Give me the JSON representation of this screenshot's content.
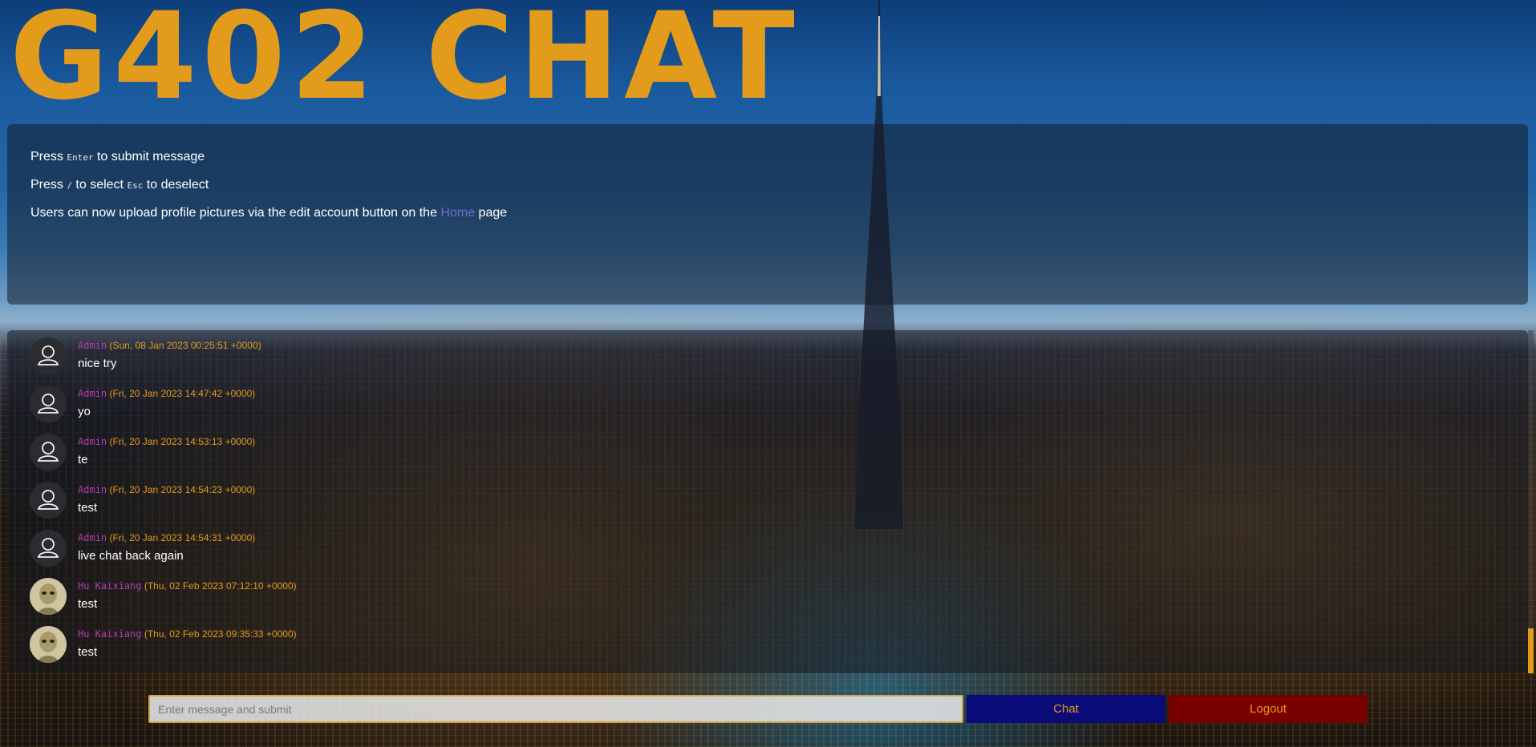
{
  "brand": {
    "title": "G402 CHAT"
  },
  "info": {
    "line1": {
      "pre": "Press ",
      "key": "Enter",
      "post": " to submit message"
    },
    "line2": {
      "pre": "Press ",
      "key1": "/",
      "mid": " to select ",
      "key2": "Esc",
      "post": " to deselect"
    },
    "line3": {
      "pre": "Users can now upload profile pictures via the edit account button on the ",
      "link": "Home",
      "post": " page"
    }
  },
  "messages": [
    {
      "author": "Admin",
      "timestamp": "(Sun, 08 Jan 2023 00:25:51 +0000)",
      "text": "nice try",
      "avatar": "default-user-icon"
    },
    {
      "author": "Admin",
      "timestamp": "(Fri, 20 Jan 2023 14:47:42 +0000)",
      "text": "yo",
      "avatar": "default-user-icon"
    },
    {
      "author": "Admin",
      "timestamp": "(Fri, 20 Jan 2023 14:53:13 +0000)",
      "text": "te",
      "avatar": "default-user-icon"
    },
    {
      "author": "Admin",
      "timestamp": "(Fri, 20 Jan 2023 14:54:23 +0000)",
      "text": "test",
      "avatar": "default-user-icon"
    },
    {
      "author": "Admin",
      "timestamp": "(Fri, 20 Jan 2023 14:54:31 +0000)",
      "text": "live chat back again",
      "avatar": "default-user-icon"
    },
    {
      "author": "Hu Kaixiang",
      "timestamp": "(Thu, 02 Feb 2023 07:12:10 +0000)",
      "text": "test",
      "avatar": "profile-photo"
    },
    {
      "author": "Hu Kaixiang",
      "timestamp": "(Thu, 02 Feb 2023 09:35:33 +0000)",
      "text": "test",
      "avatar": "profile-photo"
    }
  ],
  "composer": {
    "placeholder": "Enter message and submit",
    "value": "",
    "chat_label": "Chat",
    "logout_label": "Logout"
  },
  "colors": {
    "accent": "#e39b1c",
    "author": "#b43cb4",
    "chat_button": "#0a0a78",
    "logout_button": "#7a0000"
  }
}
